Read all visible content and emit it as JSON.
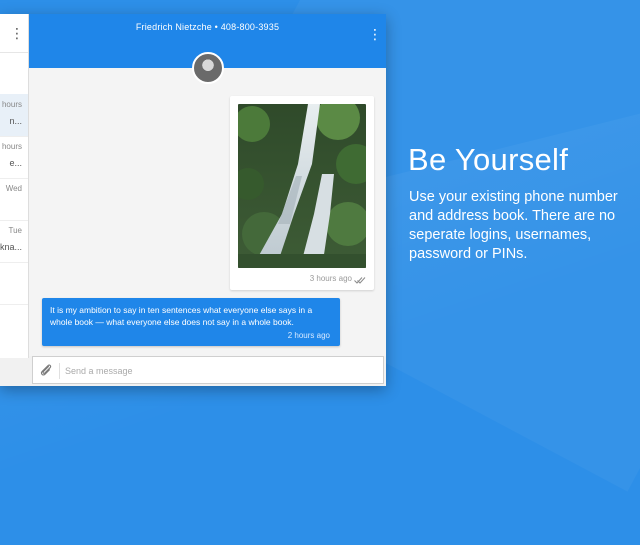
{
  "colors": {
    "brand_blue": "#1f86e9",
    "background": "#2d8fe8"
  },
  "sidebar": {
    "menu_icon": "more-vert-icon",
    "conversations": [
      {
        "time": "hours",
        "snippet": "n..."
      },
      {
        "time": "hours",
        "snippet": "e..."
      },
      {
        "time": "Wed",
        "snippet": ""
      },
      {
        "time": "Tue",
        "snippet": "kna..."
      }
    ]
  },
  "header": {
    "contact": "Friedrich Nietzche • 408-800-3935",
    "menu_icon": "more-vert-icon"
  },
  "messages": [
    {
      "type": "image",
      "time": "3 hours ago",
      "status_icon": "double-check-icon"
    },
    {
      "type": "text",
      "text": "It is my ambition to say in ten sentences what everyone else says in a whole book — what everyone else does not say in a whole book.",
      "time": "2 hours ago"
    }
  ],
  "composer": {
    "placeholder": "Send a message",
    "attach_icon": "paperclip-icon"
  },
  "promo": {
    "title": "Be Yourself",
    "body": "Use your existing phone number and address book. There are no seperate logins, usernames, password or PINs."
  }
}
